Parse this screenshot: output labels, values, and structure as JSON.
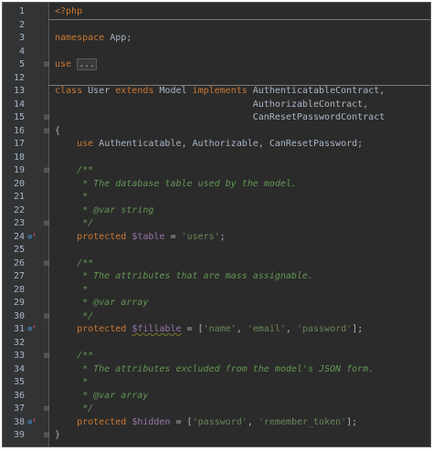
{
  "editor": {
    "lines": [
      {
        "num": "1",
        "parts": [
          {
            "t": "<?php",
            "c": "php"
          }
        ]
      },
      {
        "num": "2",
        "parts": []
      },
      {
        "num": "3",
        "parts": [
          {
            "t": "namespace",
            "c": "kw"
          },
          {
            "t": " App;",
            "c": ""
          }
        ]
      },
      {
        "num": "4",
        "parts": []
      },
      {
        "num": "5",
        "fold": "⊟",
        "parts": [
          {
            "t": "use",
            "c": "kw"
          },
          {
            "t": " ",
            "c": ""
          },
          {
            "t": "...",
            "c": "ellipsis"
          }
        ]
      },
      {
        "num": "12",
        "parts": []
      },
      {
        "num": "13",
        "parts": [
          {
            "t": "class",
            "c": "kw"
          },
          {
            "t": " User ",
            "c": ""
          },
          {
            "t": "extends",
            "c": "kw"
          },
          {
            "t": " Model ",
            "c": ""
          },
          {
            "t": "implements",
            "c": "kw"
          },
          {
            "t": " AuthenticatableContract,",
            "c": ""
          }
        ]
      },
      {
        "num": "14",
        "parts": [
          {
            "t": "                                    AuthorizableContract,",
            "c": ""
          }
        ]
      },
      {
        "num": "15",
        "fold": "⊟",
        "parts": [
          {
            "t": "                                    CanResetPasswordContract",
            "c": ""
          }
        ]
      },
      {
        "num": "16",
        "fold": "⊟",
        "parts": [
          {
            "t": "{",
            "c": ""
          }
        ]
      },
      {
        "num": "17",
        "parts": [
          {
            "t": "    ",
            "c": ""
          },
          {
            "t": "use",
            "c": "kw"
          },
          {
            "t": " Authenticatable, Authorizable, CanResetPassword;",
            "c": ""
          }
        ]
      },
      {
        "num": "18",
        "parts": []
      },
      {
        "num": "19",
        "fold": "⊟",
        "parts": [
          {
            "t": "    /**",
            "c": "cmt"
          }
        ]
      },
      {
        "num": "20",
        "parts": [
          {
            "t": "     * The database table used by the model.",
            "c": "cmt"
          }
        ]
      },
      {
        "num": "21",
        "parts": [
          {
            "t": "     *",
            "c": "cmt"
          }
        ]
      },
      {
        "num": "22",
        "parts": [
          {
            "t": "     * @var string",
            "c": "cmt"
          }
        ]
      },
      {
        "num": "23",
        "fold": "⊟",
        "parts": [
          {
            "t": "     */",
            "c": "cmt"
          }
        ]
      },
      {
        "num": "24",
        "marker": true,
        "parts": [
          {
            "t": "    ",
            "c": ""
          },
          {
            "t": "protected",
            "c": "kw"
          },
          {
            "t": " ",
            "c": ""
          },
          {
            "t": "$table",
            "c": "var"
          },
          {
            "t": " = ",
            "c": ""
          },
          {
            "t": "'users'",
            "c": "str"
          },
          {
            "t": ";",
            "c": ""
          }
        ]
      },
      {
        "num": "25",
        "parts": []
      },
      {
        "num": "26",
        "fold": "⊟",
        "parts": [
          {
            "t": "    /**",
            "c": "cmt"
          }
        ]
      },
      {
        "num": "27",
        "parts": [
          {
            "t": "     * The attributes that are mass assignable.",
            "c": "cmt"
          }
        ]
      },
      {
        "num": "28",
        "parts": [
          {
            "t": "     *",
            "c": "cmt"
          }
        ]
      },
      {
        "num": "29",
        "parts": [
          {
            "t": "     * @var array",
            "c": "cmt"
          }
        ]
      },
      {
        "num": "30",
        "fold": "⊟",
        "parts": [
          {
            "t": "     */",
            "c": "cmt"
          }
        ]
      },
      {
        "num": "31",
        "marker": true,
        "parts": [
          {
            "t": "    ",
            "c": ""
          },
          {
            "t": "protected",
            "c": "kw"
          },
          {
            "t": " ",
            "c": ""
          },
          {
            "t": "$fillable",
            "c": "var squiggle"
          },
          {
            "t": " = [",
            "c": ""
          },
          {
            "t": "'name'",
            "c": "str"
          },
          {
            "t": ", ",
            "c": ""
          },
          {
            "t": "'email'",
            "c": "str"
          },
          {
            "t": ", ",
            "c": ""
          },
          {
            "t": "'password'",
            "c": "str"
          },
          {
            "t": "];",
            "c": ""
          }
        ]
      },
      {
        "num": "32",
        "parts": []
      },
      {
        "num": "33",
        "fold": "⊟",
        "parts": [
          {
            "t": "    /**",
            "c": "cmt"
          }
        ]
      },
      {
        "num": "34",
        "parts": [
          {
            "t": "     * The attributes excluded from the model's JSON form.",
            "c": "cmt"
          }
        ]
      },
      {
        "num": "35",
        "parts": [
          {
            "t": "     *",
            "c": "cmt"
          }
        ]
      },
      {
        "num": "36",
        "parts": [
          {
            "t": "     * @var array",
            "c": "cmt"
          }
        ]
      },
      {
        "num": "37",
        "fold": "⊟",
        "parts": [
          {
            "t": "     */",
            "c": "cmt"
          }
        ]
      },
      {
        "num": "38",
        "marker": true,
        "parts": [
          {
            "t": "    ",
            "c": ""
          },
          {
            "t": "protected",
            "c": "kw"
          },
          {
            "t": " ",
            "c": ""
          },
          {
            "t": "$hidden",
            "c": "var"
          },
          {
            "t": " = [",
            "c": ""
          },
          {
            "t": "'password'",
            "c": "str"
          },
          {
            "t": ", ",
            "c": ""
          },
          {
            "t": "'remember_token'",
            "c": "str"
          },
          {
            "t": "];",
            "c": ""
          }
        ]
      },
      {
        "num": "39",
        "fold": "⊟",
        "parts": [
          {
            "t": "}",
            "c": ""
          }
        ]
      }
    ],
    "separator_after_lines": [
      "1",
      "12"
    ],
    "marker_glyph": "⊚",
    "marker_up_glyph": "↑"
  }
}
